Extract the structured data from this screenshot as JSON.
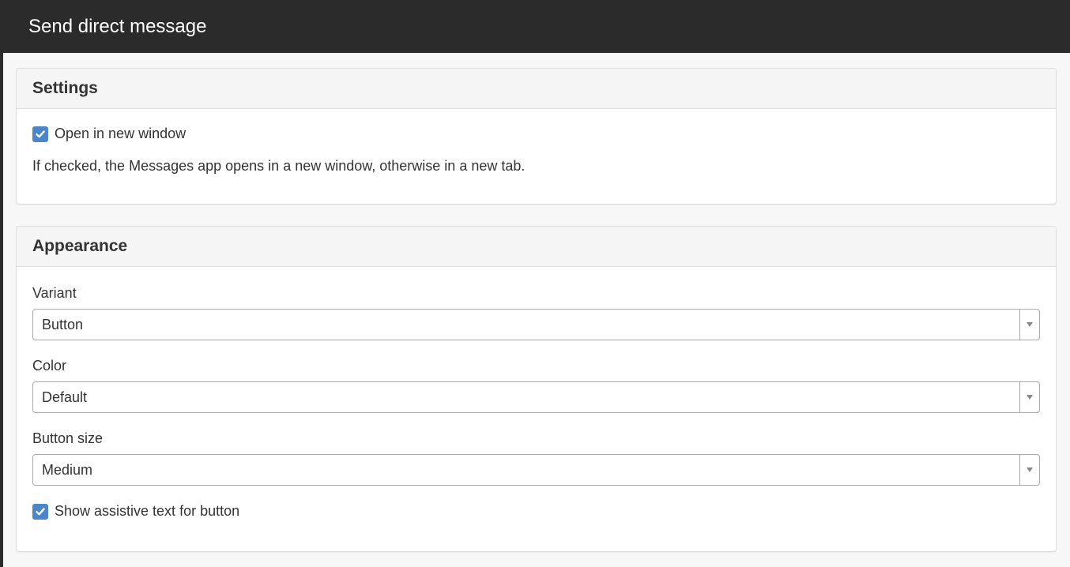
{
  "header": {
    "title": "Send direct message"
  },
  "settings": {
    "heading": "Settings",
    "open_new_window": {
      "label": "Open in new window",
      "checked": true
    },
    "help_text": "If checked, the Messages app opens in a new window, otherwise in a new tab."
  },
  "appearance": {
    "heading": "Appearance",
    "variant": {
      "label": "Variant",
      "value": "Button"
    },
    "color": {
      "label": "Color",
      "value": "Default"
    },
    "button_size": {
      "label": "Button size",
      "value": "Medium"
    },
    "assistive_text": {
      "label": "Show assistive text for button",
      "checked": true
    }
  },
  "colors": {
    "topbar": "#2b2b2b",
    "checkbox_accent": "#4a86c8",
    "panel_heading_bg": "#f5f5f5"
  }
}
